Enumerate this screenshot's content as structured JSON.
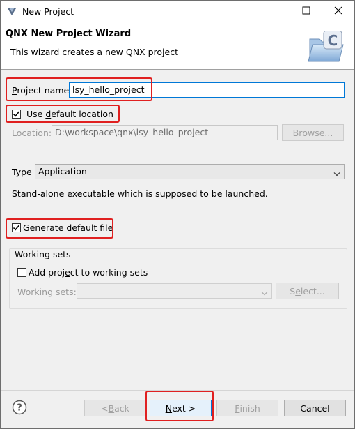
{
  "window": {
    "title": "New Project",
    "maximize_symbol": "☐",
    "close_symbol": "✕",
    "app_icon": "qnx-momentics-icon"
  },
  "header": {
    "title": "QNX New Project Wizard",
    "description": "This wizard creates a new QNX project",
    "image_icon": "new-c-project-folder-icon"
  },
  "project": {
    "name_label_first": "P",
    "name_label_rest": "roject name:",
    "name_value": "lsy_hello_project",
    "use_default_prefix": "Use ",
    "use_default_mnemonic": "d",
    "use_default_rest": "efault location",
    "use_default_checked": true,
    "location_label_first": "L",
    "location_label_rest": "ocation:",
    "location_value": "D:\\workspace\\qnx\\lsy_hello_project",
    "browse_prefix": "B",
    "browse_mnemonic": "r",
    "browse_rest": "owse..."
  },
  "type": {
    "label": "Type",
    "selected": "Application",
    "description": "Stand-alone executable which is supposed to be launched."
  },
  "generate": {
    "label": "Generate default file",
    "checked": true
  },
  "working_sets": {
    "group_label": "Working sets",
    "add_prefix": "Add proj",
    "add_mnemonic": "e",
    "add_rest": "ct to working sets",
    "add_checked": false,
    "sets_prefix": "W",
    "sets_mnemonic": "o",
    "sets_rest": "rking sets:",
    "sets_value": "",
    "select_prefix": "S",
    "select_mnemonic": "e",
    "select_rest": "lect..."
  },
  "footer": {
    "back_prefix": "< ",
    "back_mnemonic": "B",
    "back_rest": "ack",
    "next_mnemonic": "N",
    "next_rest": "ext >",
    "finish_mnemonic": "F",
    "finish_rest": "inish",
    "cancel": "Cancel",
    "help_symbol": "?"
  },
  "colors": {
    "highlight_box": "#e02020",
    "focus": "#0078d7",
    "dialog_bg": "#f0f0f0"
  }
}
